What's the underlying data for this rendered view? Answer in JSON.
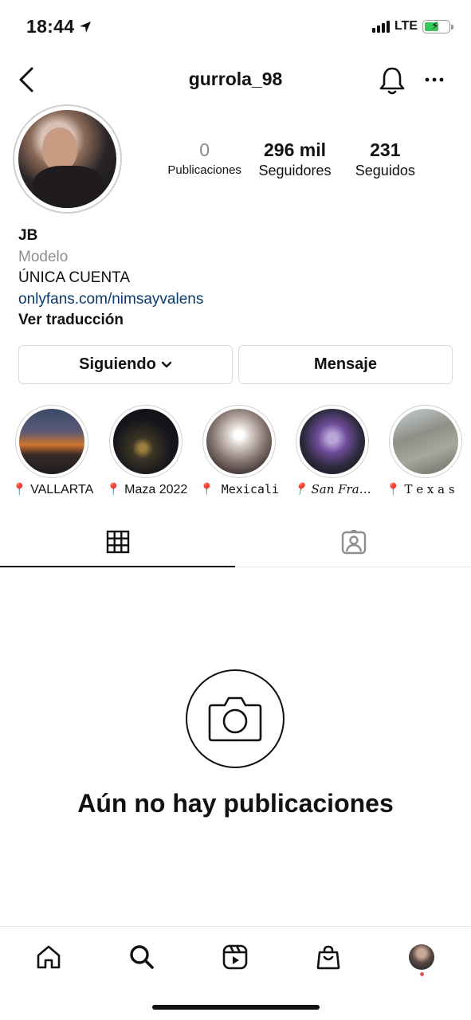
{
  "status_bar": {
    "time": "18:44",
    "network": "LTE"
  },
  "header": {
    "username": "gurrola_98"
  },
  "stats": [
    {
      "value": "0",
      "label": "Publicaciones"
    },
    {
      "value": "296 mil",
      "label": "Seguidores"
    },
    {
      "value": "231",
      "label": "Seguidos"
    }
  ],
  "bio": {
    "name": "JB",
    "category": "Modelo",
    "text": "ÚNICA CUENTA",
    "link": "onlyfans.com/nimsayvalens",
    "translate": "Ver traducción"
  },
  "buttons": {
    "following": "Siguiendo",
    "message": "Mensaje"
  },
  "highlights": [
    {
      "pin": "📍",
      "label": "VALLARTA"
    },
    {
      "pin": "📍",
      "label": "Maza 2022"
    },
    {
      "pin": "📍",
      "label": "Mexicali"
    },
    {
      "pin": "📍",
      "label": "San Francisco"
    },
    {
      "pin": "📍",
      "label": "T e x a s"
    }
  ],
  "empty": {
    "message": "Aún no hay publicaciones"
  },
  "colors": {
    "link": "#0a3a6b",
    "battery": "#36c759",
    "notification_dot": "#e84d5a"
  }
}
